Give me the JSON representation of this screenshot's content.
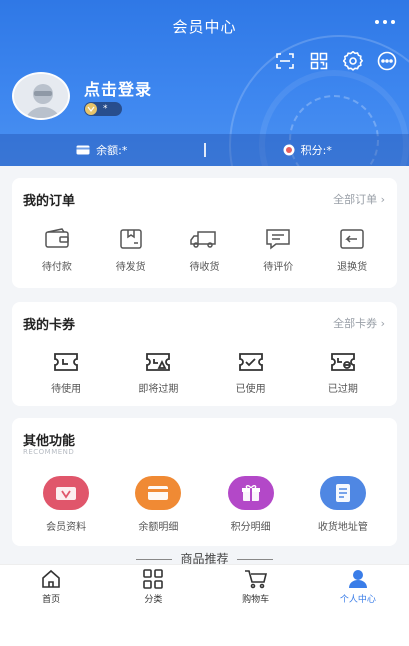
{
  "header": {
    "title": "会员中心",
    "login_text": "点击登录",
    "level": "*",
    "balance_label": "余额:*",
    "points_label": "积分:*"
  },
  "orders": {
    "title": "我的订单",
    "link": "全部订单 ›",
    "items": [
      {
        "label": "待付款",
        "icon": "wallet-icon"
      },
      {
        "label": "待发货",
        "icon": "package-icon"
      },
      {
        "label": "待收货",
        "icon": "truck-icon"
      },
      {
        "label": "待评价",
        "icon": "comment-icon"
      },
      {
        "label": "退换货",
        "icon": "return-icon"
      }
    ]
  },
  "coupons": {
    "title": "我的卡券",
    "link": "全部卡券 ›",
    "items": [
      {
        "label": "待使用",
        "icon": "ticket-icon"
      },
      {
        "label": "即将过期",
        "icon": "ticket-warning-icon"
      },
      {
        "label": "已使用",
        "icon": "ticket-check-icon"
      },
      {
        "label": "已过期",
        "icon": "ticket-expired-icon"
      }
    ]
  },
  "functions": {
    "title": "其他功能",
    "subtitle": "RECOMMEND",
    "items": [
      {
        "label": "会员资料",
        "icon": "member-icon",
        "color": "#e0566b"
      },
      {
        "label": "余额明细",
        "icon": "card-icon",
        "color": "#f08a34"
      },
      {
        "label": "积分明细",
        "icon": "gift-icon",
        "color": "#b348c8"
      },
      {
        "label": "收货地址管",
        "icon": "address-icon",
        "color": "#4f87e3"
      }
    ]
  },
  "recommend_title": "商品推荐",
  "tabbar": {
    "items": [
      {
        "label": "首页",
        "icon": "home-icon"
      },
      {
        "label": "分类",
        "icon": "category-icon"
      },
      {
        "label": "购物车",
        "icon": "cart-icon"
      },
      {
        "label": "个人中心",
        "icon": "user-icon",
        "active": true
      }
    ]
  },
  "colors": {
    "primary": "#3a7de8",
    "header_gradient_top": "#2f78e6"
  }
}
